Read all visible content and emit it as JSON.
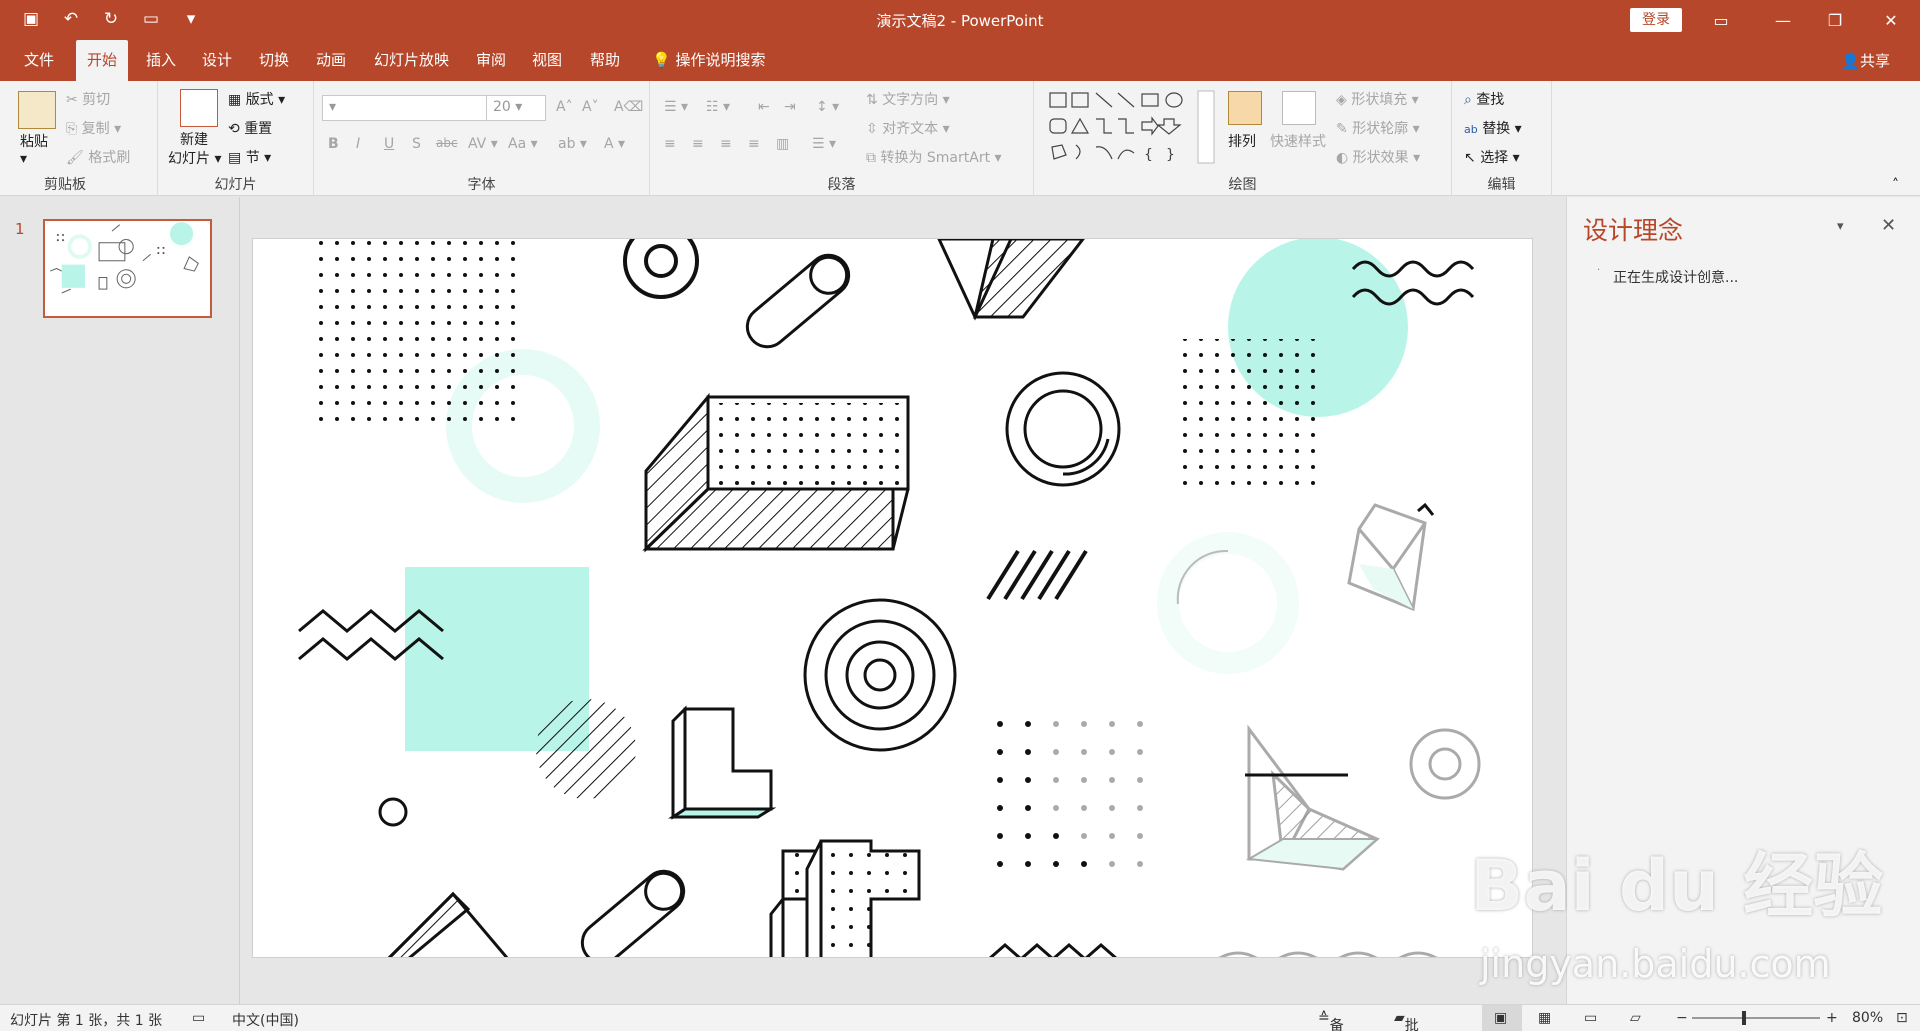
{
  "window": {
    "title": "演示文稿2 - PowerPoint",
    "login_label": "登录"
  },
  "tabs": [
    "文件",
    "开始",
    "插入",
    "设计",
    "切换",
    "动画",
    "幻灯片放映",
    "审阅",
    "视图",
    "帮助"
  ],
  "tell_me": "操作说明搜索",
  "share_label": "共享",
  "clipboard": {
    "paste": "粘贴",
    "cut": "剪切",
    "copy": "复制",
    "format_painter": "格式刷",
    "label": "剪贴板"
  },
  "slides_group": {
    "new_slide_line1": "新建",
    "new_slide_line2": "幻灯片",
    "layout": "版式",
    "reset": "重置",
    "section": "节",
    "label": "幻灯片"
  },
  "font_group": {
    "font_size": "20",
    "label": "字体"
  },
  "paragraph_group": {
    "text_direction": "文字方向",
    "align_text": "对齐文本",
    "convert_smartart": "转换为 SmartArt",
    "label": "段落"
  },
  "drawing_group": {
    "arrange": "排列",
    "quick_styles": "快速样式",
    "shape_fill": "形状填充",
    "shape_outline": "形状轮廓",
    "shape_effects": "形状效果",
    "label": "绘图"
  },
  "editing_group": {
    "find": "查找",
    "replace": "替换",
    "select": "选择",
    "label": "编辑"
  },
  "thumb": {
    "number": "1"
  },
  "design_pane": {
    "title": "设计理念",
    "message": "正在生成设计创意..."
  },
  "status": {
    "slide_info": "幻灯片 第 1 张，共 1 张",
    "language": "中文(中国)",
    "notes": "备注",
    "comments": "批注",
    "zoom": "80%"
  },
  "watermark": {
    "brand": "Bai du 经验",
    "url": "jingyan.baidu.com"
  },
  "colors": {
    "accent": "#b7472a",
    "mint": "#b8f5e8"
  }
}
